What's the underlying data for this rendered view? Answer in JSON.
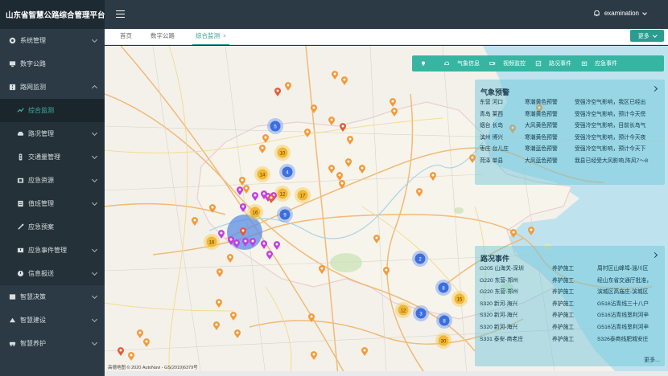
{
  "app": {
    "title": "山东省智慧公路综合管理平台"
  },
  "sidebar": {
    "items": [
      {
        "label": "系统管理",
        "icon": "gear-icon"
      },
      {
        "label": "数字公路",
        "icon": "screen-icon"
      },
      {
        "label": "路网监测",
        "icon": "road-icon"
      }
    ],
    "subitems": [
      {
        "label": "综合监测",
        "icon": "monitor-icon"
      },
      {
        "label": "路况管理",
        "icon": "car-icon"
      },
      {
        "label": "交通量管理",
        "icon": "traffic-icon"
      },
      {
        "label": "应急资源",
        "icon": "folder-icon"
      },
      {
        "label": "值班管理",
        "icon": "duty-icon"
      },
      {
        "label": "应急预案",
        "icon": "plan-icon"
      },
      {
        "label": "应急事件管理",
        "icon": "alert-icon"
      },
      {
        "label": "信息报送",
        "icon": "report-icon"
      }
    ],
    "bottom_items": [
      {
        "label": "智慧决策",
        "icon": "decision-icon"
      },
      {
        "label": "智慧建设",
        "icon": "build-icon"
      },
      {
        "label": "智慧养护",
        "icon": "maint-icon"
      }
    ]
  },
  "topbar": {
    "username": "examination"
  },
  "tabs": [
    {
      "label": "首页"
    },
    {
      "label": "数字公路"
    },
    {
      "label": "综合监测",
      "closable": "×"
    }
  ],
  "more_button": "更多",
  "categories": [
    {
      "label": "气象信息",
      "icon": "weather-icon"
    },
    {
      "label": "视频监控",
      "icon": "camera-icon"
    },
    {
      "label": "路况事件",
      "icon": "event-icon"
    },
    {
      "label": "应急事件",
      "icon": "emergency-icon"
    }
  ],
  "weather_panel": {
    "title": "气象预警",
    "rows": [
      [
        "东营 河口",
        "寒潮黄色预警",
        "受强冷空气影响，我区已经出"
      ],
      [
        "青岛 莱西",
        "寒潮黄色预警",
        "受强冷空气影响，预计今天傍"
      ],
      [
        "烟台 长岛",
        "大风黄色预警",
        "受强冷空气影响，目前长岛气"
      ],
      [
        "滨州 博兴",
        "寒潮黄色预警",
        "受强冷空气影响，预计今天夜"
      ],
      [
        "枣庄 台儿庄",
        "寒潮蓝色预警",
        "受强冷空气影响，预计今天下"
      ],
      [
        "菏泽 单县",
        "大风蓝色预警",
        "我县已经受大风影响,阵风7～8"
      ]
    ]
  },
  "event_panel": {
    "title": "路况事件",
    "more": "更多...",
    "rows": [
      [
        "G205 山海关-深圳",
        "养护施工",
        "周村区山峰埠-淄川区"
      ],
      [
        "G220 东营-郑州",
        "养护施工",
        "经山东省交通厅批准，"
      ],
      [
        "G220 东营-郑州",
        "养护施工",
        "滨城区高庙庄-滨城区"
      ],
      [
        "S320 新河-海兴",
        "养护施工",
        "G516沾青线三十八户"
      ],
      [
        "S320 新河-海兴",
        "养护施工",
        "G516沾青线垦利河辛"
      ],
      [
        "S320 新河-海兴",
        "养护施工",
        "G516沾青线垦利河辛"
      ],
      [
        "S331 泰安-商老庄",
        "养护施工",
        "S326泰商线肥城安庄"
      ]
    ]
  },
  "map": {
    "attribution": "高德地图 © 2020 AutoNavi - GS(2019)6379号",
    "clusters": [
      {
        "count": "5",
        "color": "blue"
      },
      {
        "count": "10",
        "color": "yellow"
      },
      {
        "count": "4",
        "color": "blue"
      },
      {
        "count": "14",
        "color": "yellow"
      },
      {
        "count": "12",
        "color": "yellow"
      },
      {
        "count": "17",
        "color": "yellow"
      },
      {
        "count": "16",
        "color": "yellow"
      },
      {
        "count": "9",
        "color": "blue"
      },
      {
        "count": "16",
        "color": "yellow"
      },
      {
        "count": "2",
        "color": "blue"
      },
      {
        "count": "8",
        "color": "blue"
      },
      {
        "count": "12",
        "color": "yellow"
      },
      {
        "count": "3",
        "color": "blue"
      },
      {
        "count": "15",
        "color": "yellow"
      },
      {
        "count": "8",
        "color": "blue"
      },
      {
        "count": "30",
        "color": "yellow"
      }
    ]
  },
  "colors": {
    "accent": "#2a9d8f",
    "sidebar": "#2b3a44",
    "panel": "#68c4d9"
  }
}
